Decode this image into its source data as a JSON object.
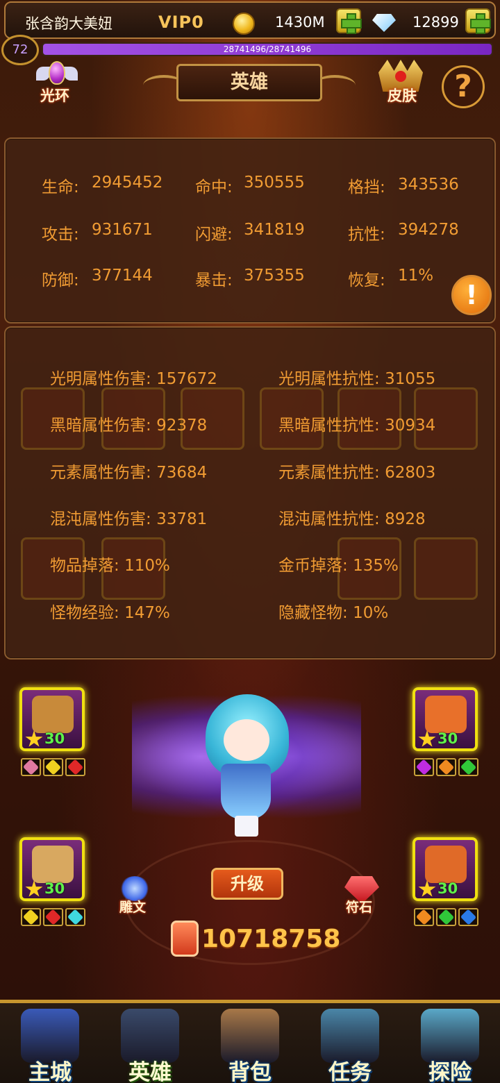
{
  "player": {
    "name": "张含韵大美妞",
    "vip": "VIP0",
    "gold": "1430M",
    "diamonds": "12899",
    "level": "72",
    "exp": "28741496/28741496",
    "exp_fraction": 1.0
  },
  "header": {
    "halo_label": "光环",
    "title": "英雄",
    "skin_label": "皮肤",
    "help_symbol": "?"
  },
  "basic_stats": [
    {
      "label": "生命:",
      "value": "2945452"
    },
    {
      "label": "命中:",
      "value": "350555"
    },
    {
      "label": "格挡:",
      "value": "343536"
    },
    {
      "label": "攻击:",
      "value": "931671"
    },
    {
      "label": "闪避:",
      "value": "341819"
    },
    {
      "label": "抗性:",
      "value": "394278"
    },
    {
      "label": "防御:",
      "value": "377144"
    },
    {
      "label": "暴击:",
      "value": "375355"
    },
    {
      "label": "恢复:",
      "value": "11%"
    }
  ],
  "info_symbol": "!",
  "element_stats": [
    {
      "label": "光明属性伤害:",
      "value": "157672"
    },
    {
      "label": "光明属性抗性:",
      "value": "31055"
    },
    {
      "label": "黑暗属性伤害:",
      "value": "92378"
    },
    {
      "label": "黑暗属性抗性:",
      "value": "30934"
    },
    {
      "label": "元素属性伤害:",
      "value": "73684"
    },
    {
      "label": "元素属性抗性:",
      "value": "62803"
    },
    {
      "label": "混沌属性伤害:",
      "value": "33781"
    },
    {
      "label": "混沌属性抗性:",
      "value": "8928"
    },
    {
      "label": "物品掉落:",
      "value": "110%"
    },
    {
      "label": "金币掉落:",
      "value": "135%"
    },
    {
      "label": "怪物经验:",
      "value": "147%"
    },
    {
      "label": "隐藏怪物:",
      "value": "10%"
    }
  ],
  "equipment": [
    {
      "slot": "shield",
      "level": "30",
      "gems": [
        "pink",
        "yellow",
        "red"
      ],
      "color": "#c88a3a"
    },
    {
      "slot": "crown",
      "level": "30",
      "gems": [
        "purple",
        "orange",
        "green"
      ],
      "color": "#e8702a"
    },
    {
      "slot": "wings",
      "level": "30",
      "gems": [
        "yellow",
        "red",
        "cyan"
      ],
      "color": "#d8a860"
    },
    {
      "slot": "fox",
      "level": "30",
      "gems": [
        "orange",
        "green",
        "blue"
      ],
      "color": "#e06a28"
    }
  ],
  "actions": {
    "rune_label": "雕文",
    "upgrade_label": "升级",
    "stone_label": "符石",
    "power": "10718758"
  },
  "nav": [
    {
      "label": "主城",
      "icon": "castle-icon",
      "color": "#3a5ab8",
      "active": false
    },
    {
      "label": "英雄",
      "icon": "hero-helmet-icon",
      "color": "#3a4a6a",
      "active": true
    },
    {
      "label": "背包",
      "icon": "backpack-icon",
      "color": "#a87848",
      "active": false
    },
    {
      "label": "任务",
      "icon": "tower-icon",
      "color": "#4a86a8",
      "active": false
    },
    {
      "label": "探险",
      "icon": "portal-icon",
      "color": "#5aa8c8",
      "active": false
    }
  ]
}
